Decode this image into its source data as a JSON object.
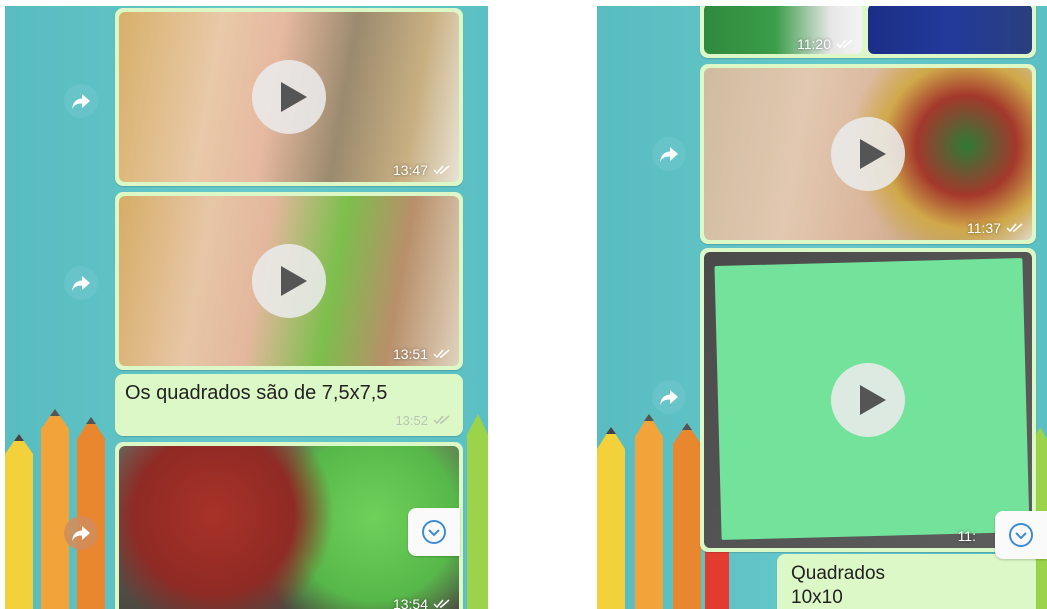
{
  "left_screen": {
    "messages": [
      {
        "type": "video",
        "time": "13:47"
      },
      {
        "type": "video",
        "time": "13:51"
      },
      {
        "type": "text",
        "text": "Os quadrados são de 7,5x7,5",
        "time": "13:52"
      },
      {
        "type": "video",
        "time": "13:54"
      }
    ]
  },
  "right_screen": {
    "messages": [
      {
        "type": "video",
        "time": "11:20"
      },
      {
        "type": "video",
        "time": "11:37"
      },
      {
        "type": "video",
        "time": "11:"
      },
      {
        "type": "text",
        "text_line1": "Quadrados",
        "text_line2": "10x10"
      }
    ]
  },
  "icons": {
    "play": "play-icon",
    "forward": "forward-arrow-icon",
    "scroll": "chevron-down-circle-icon",
    "read": "double-check-icon"
  },
  "colors": {
    "wallpaper": "#5ec3c6",
    "bubble": "#dcf8c6",
    "read_ticks": "#4fc3f7"
  }
}
